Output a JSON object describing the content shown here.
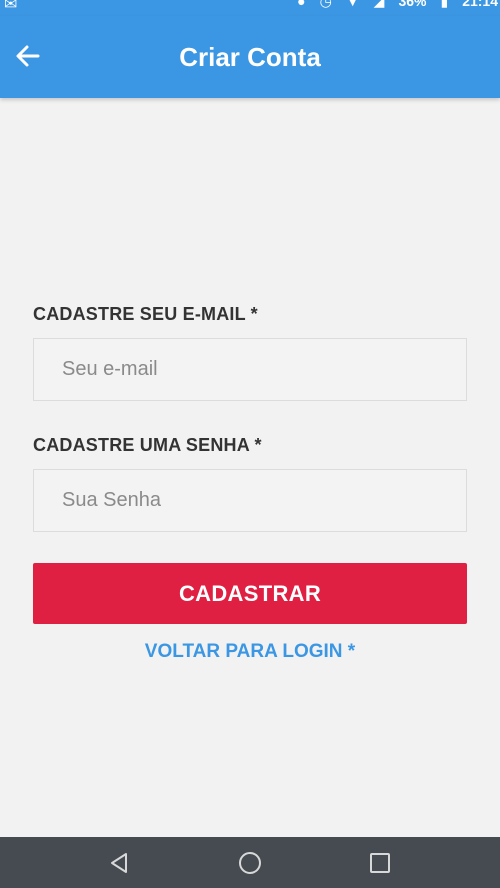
{
  "status_bar": {
    "battery": "36%",
    "time": "21:14"
  },
  "app_bar": {
    "title": "Criar Conta"
  },
  "form": {
    "email_label": "CADASTRE SEU E-MAIL *",
    "email_placeholder": "Seu e-mail",
    "password_label": "CADASTRE UMA SENHA *",
    "password_placeholder": "Sua Senha",
    "submit_label": "CADASTRAR",
    "back_to_login": "VOLTAR PARA LOGIN *"
  },
  "colors": {
    "primary": "#3b97e3",
    "accent": "#e02042",
    "background": "#f2f2f2",
    "nav_bar": "#454b50"
  },
  "icons": {
    "back": "arrow-left-icon",
    "nav_back": "triangle-back-icon",
    "nav_home": "circle-home-icon",
    "nav_recent": "square-recent-icon"
  }
}
